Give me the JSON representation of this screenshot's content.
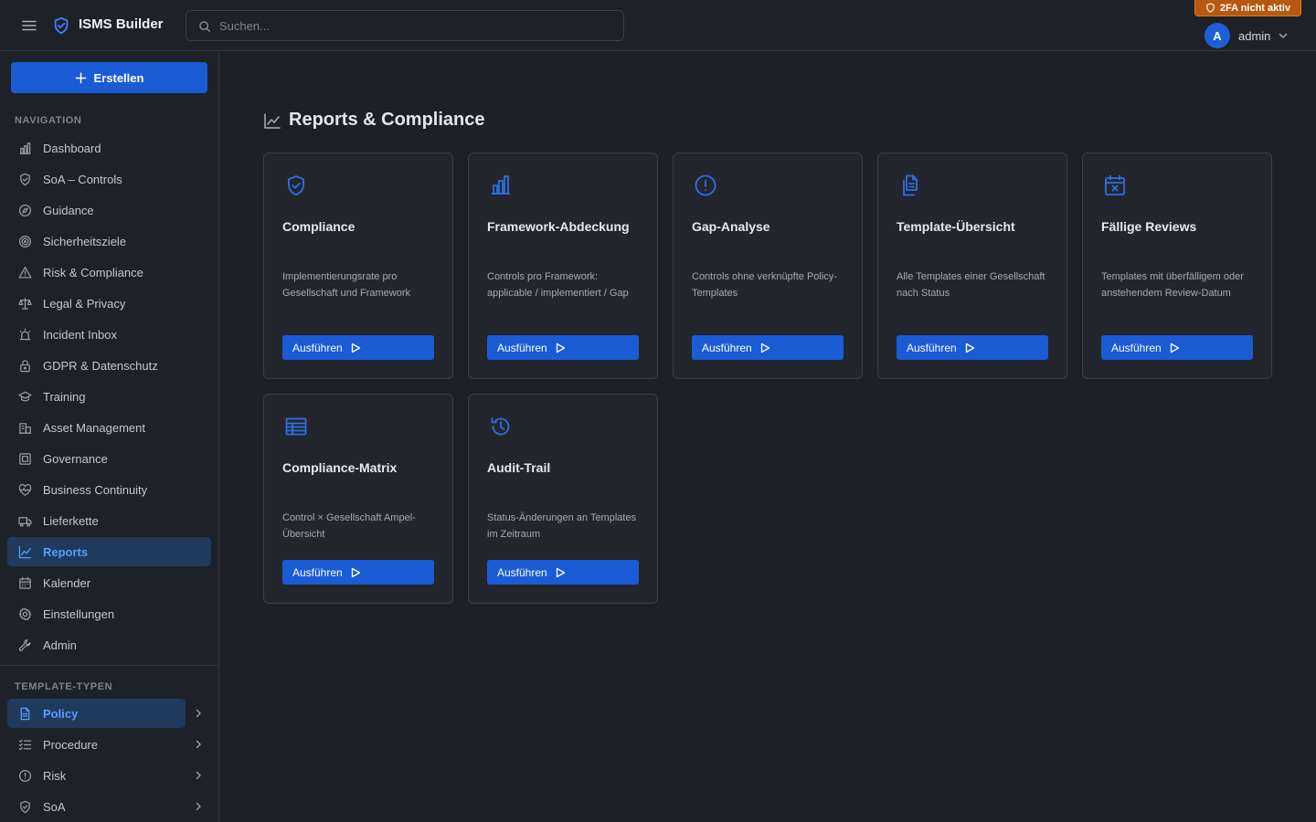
{
  "header": {
    "app_title": "ISMS Builder",
    "search_placeholder": "Suchen...",
    "twofa_badge": "2FA nicht aktiv",
    "user_initial": "A",
    "username": "admin"
  },
  "sidebar": {
    "create_label": "Erstellen",
    "nav_title": "NAVIGATION",
    "nav_items": [
      {
        "label": "Dashboard",
        "icon": "bar-chart-icon"
      },
      {
        "label": "SoA – Controls",
        "icon": "shield-check-icon"
      },
      {
        "label": "Guidance",
        "icon": "compass-icon"
      },
      {
        "label": "Sicherheitsziele",
        "icon": "target-icon"
      },
      {
        "label": "Risk & Compliance",
        "icon": "warning-triangle-icon"
      },
      {
        "label": "Legal & Privacy",
        "icon": "scale-icon"
      },
      {
        "label": "Incident Inbox",
        "icon": "alarm-icon"
      },
      {
        "label": "GDPR & Datenschutz",
        "icon": "lock-icon"
      },
      {
        "label": "Training",
        "icon": "graduation-cap-icon"
      },
      {
        "label": "Asset Management",
        "icon": "buildings-icon"
      },
      {
        "label": "Governance",
        "icon": "file-scan-icon"
      },
      {
        "label": "Business Continuity",
        "icon": "heart-pulse-icon"
      },
      {
        "label": "Lieferkette",
        "icon": "truck-icon"
      },
      {
        "label": "Reports",
        "icon": "line-chart-icon",
        "active": true
      },
      {
        "label": "Kalender",
        "icon": "calendar-icon"
      },
      {
        "label": "Einstellungen",
        "icon": "gear-icon"
      },
      {
        "label": "Admin",
        "icon": "wrench-icon"
      }
    ],
    "template_title": "TEMPLATE-TYPEN",
    "template_items": [
      {
        "label": "Policy",
        "icon": "document-icon",
        "active": true
      },
      {
        "label": "Procedure",
        "icon": "list-checks-icon"
      },
      {
        "label": "Risk",
        "icon": "alert-circle-icon"
      },
      {
        "label": "SoA",
        "icon": "shield-check-icon"
      }
    ]
  },
  "main": {
    "title": "Reports & Compliance",
    "run_label": "Ausführen",
    "cards": [
      {
        "title": "Compliance",
        "desc": "Implementierungsrate pro Gesellschaft und Framework",
        "icon": "shield-check-icon"
      },
      {
        "title": "Framework-Abdeckung",
        "desc": "Controls pro Framework: applicable / implementiert / Gap",
        "icon": "bar-chart-icon"
      },
      {
        "title": "Gap-Analyse",
        "desc": "Controls ohne verknüpfte Policy-Templates",
        "icon": "alert-circle-icon"
      },
      {
        "title": "Template-Übersicht",
        "desc": "Alle Templates einer Gesellschaft nach Status",
        "icon": "documents-icon"
      },
      {
        "title": "Fällige Reviews",
        "desc": "Templates mit überfälligem oder anstehendem Review-Datum",
        "icon": "calendar-x-icon"
      },
      {
        "title": "Compliance-Matrix",
        "desc": "Control × Gesellschaft Ampel-Übersicht",
        "icon": "table-icon"
      },
      {
        "title": "Audit-Trail",
        "desc": "Status-Änderungen an Templates im Zeitraum",
        "icon": "history-icon"
      }
    ]
  },
  "colors": {
    "accent": "#1a5bd6",
    "active_bg": "#203a5e",
    "active_text": "#5b9cff",
    "warning_badge": "#b8570f"
  }
}
